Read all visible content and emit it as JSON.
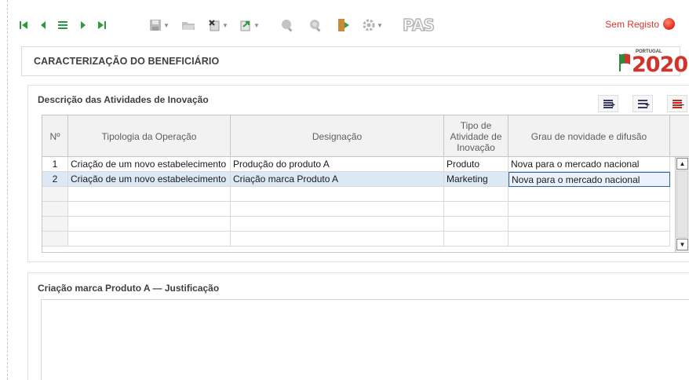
{
  "toolbar": {
    "nav": [
      {
        "name": "first-record-icon",
        "glyph": "⏮"
      },
      {
        "name": "previous-record-icon",
        "glyph": "◀"
      },
      {
        "name": "list-icon",
        "glyph": "☰"
      },
      {
        "name": "next-record-icon",
        "glyph": "▶"
      },
      {
        "name": "last-record-icon",
        "glyph": "⏭"
      }
    ],
    "status_text": "Sem Registo",
    "status_color": "#d9342b",
    "pas_logo": "PAS"
  },
  "header": {
    "title": "CARACTERIZAÇÃO DO BENEFICIÁRIO",
    "logo_small": "PORTUGAL",
    "logo_year": "2020"
  },
  "activities": {
    "title": "Descrição das Atividades de Inovação",
    "columns": {
      "num": "Nº",
      "tipologia": "Tipologia da Operação",
      "designacao": "Designação",
      "tipo": "Tipo de Atividade de Inovação",
      "grau": "Grau de novidade e difusão"
    },
    "rows": [
      {
        "num": "1",
        "tipologia": "Criação de um novo estabelecimento",
        "designacao": "Produção do produto A",
        "tipo": "Produto",
        "grau": "Nova para o mercado nacional"
      },
      {
        "num": "2",
        "tipologia": "Criação de um novo estabelecimento",
        "designacao": "Criação marca Produto A",
        "tipo": "Marketing",
        "grau": "Nova para o mercado nacional"
      }
    ],
    "selected_row": 2
  },
  "justification": {
    "title": "Criação marca Produto A — Justificação",
    "value": ""
  }
}
